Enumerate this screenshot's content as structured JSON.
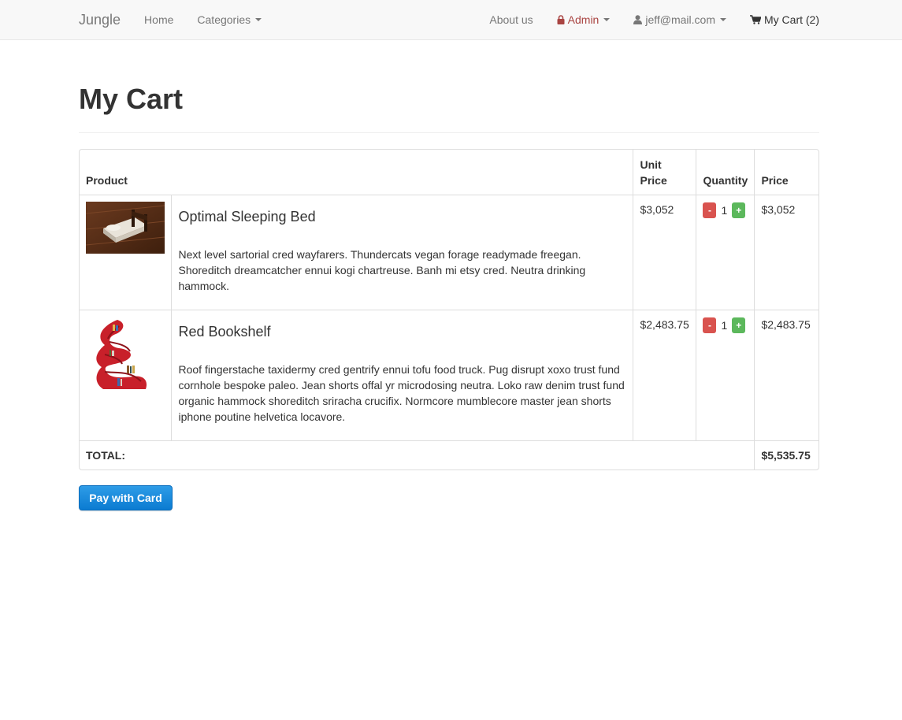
{
  "navbar": {
    "brand": "Jungle",
    "home": "Home",
    "categories": "Categories",
    "about": "About us",
    "admin": "Admin",
    "user_email": "jeff@mail.com",
    "cart": "My Cart (2)"
  },
  "page": {
    "title": "My Cart"
  },
  "table": {
    "headers": {
      "product": "Product",
      "unit_price": "Unit Price",
      "quantity": "Quantity",
      "price": "Price"
    },
    "rows": [
      {
        "name": "Optimal Sleeping Bed",
        "description": "Next level sartorial cred wayfarers. Thundercats vegan forage readymade freegan. Shoreditch dreamcatcher ennui kogi chartreuse. Banh mi etsy cred. Neutra drinking hammock.",
        "unit_price": "$3,052",
        "quantity": "1",
        "price": "$3,052",
        "minus": "-",
        "plus": "+"
      },
      {
        "name": "Red Bookshelf",
        "description": "Roof fingerstache taxidermy cred gentrify ennui tofu food truck. Pug disrupt xoxo trust fund cornhole bespoke paleo. Jean shorts offal yr microdosing neutra. Loko raw denim trust fund organic hammock shoreditch sriracha crucifix. Normcore mumblecore master jean shorts iphone poutine helvetica locavore.",
        "unit_price": "$2,483.75",
        "quantity": "1",
        "price": "$2,483.75",
        "minus": "-",
        "plus": "+"
      }
    ],
    "total_label": "TOTAL:",
    "total_value": "$5,535.75"
  },
  "pay_button": "Pay with Card",
  "colors": {
    "admin": "#a94442",
    "minus_btn": "#d9534f",
    "plus_btn": "#5cb85c",
    "pay_btn": "#1a8ad9"
  }
}
